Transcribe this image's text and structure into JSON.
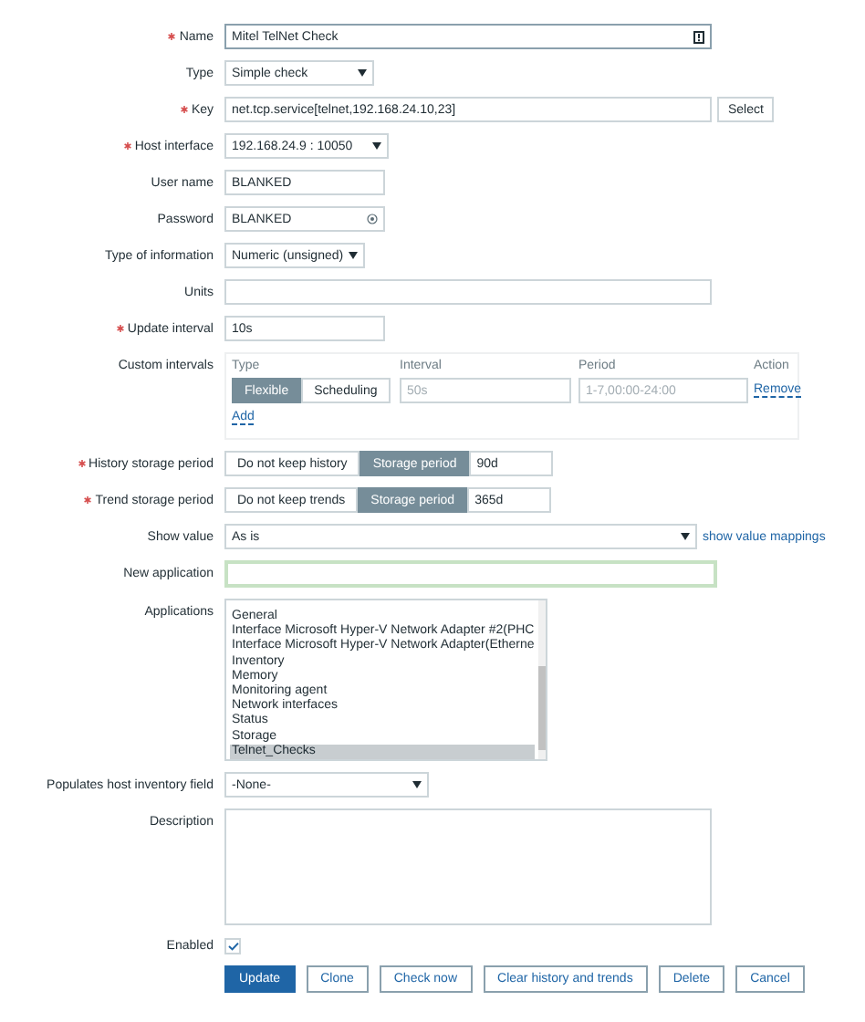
{
  "form": {
    "name": {
      "label": "Name",
      "required": true,
      "value": "Mitel TelNet Check"
    },
    "type": {
      "label": "Type",
      "required": false,
      "value": "Simple check"
    },
    "key": {
      "label": "Key",
      "required": true,
      "value": "net.tcp.service[telnet,192.168.24.10,23]",
      "button": "Select"
    },
    "host_interface": {
      "label": "Host interface",
      "required": true,
      "value": "192.168.24.9 : 10050"
    },
    "user_name": {
      "label": "User name",
      "required": false,
      "value": "BLANKED"
    },
    "password": {
      "label": "Password",
      "required": false,
      "value": "BLANKED"
    },
    "type_of_information": {
      "label": "Type of information",
      "required": false,
      "value": "Numeric (unsigned)"
    },
    "units": {
      "label": "Units",
      "required": false
    },
    "update_interval": {
      "label": "Update interval",
      "required": true,
      "value": "10s"
    },
    "custom_intervals": {
      "label": "Custom intervals",
      "columns": [
        "Type",
        "Interval",
        "Period",
        "Action"
      ],
      "rows": [
        {
          "type_options": [
            {
              "label": "Flexible",
              "selected": true
            },
            {
              "label": "Scheduling",
              "selected": false
            }
          ],
          "interval_placeholder": "50s",
          "period_placeholder": "1-7,00:00-24:00",
          "action": "Remove"
        }
      ],
      "add": "Add"
    },
    "history_storage_period": {
      "label": "History storage period",
      "required": true,
      "options": [
        {
          "label": "Do not keep history",
          "selected": false
        },
        {
          "label": "Storage period",
          "selected": true
        }
      ],
      "value": "90d"
    },
    "trend_storage_period": {
      "label": "Trend storage period",
      "required": true,
      "options": [
        {
          "label": "Do not keep trends",
          "selected": false
        },
        {
          "label": "Storage period",
          "selected": true
        }
      ],
      "value": "365d"
    },
    "show_value": {
      "label": "Show value",
      "required": false,
      "value": "As is",
      "link": "show value mappings"
    },
    "new_application": {
      "label": "New application",
      "required": false
    },
    "applications": {
      "label": "Applications",
      "items": [
        {
          "label": "General",
          "selected": false
        },
        {
          "label": "Interface Microsoft Hyper-V Network Adapter #2(PHC",
          "selected": false
        },
        {
          "label": "Interface Microsoft Hyper-V Network Adapter(Etherne",
          "selected": false
        },
        {
          "label": "Inventory",
          "selected": false
        },
        {
          "label": "Memory",
          "selected": false
        },
        {
          "label": "Monitoring agent",
          "selected": false
        },
        {
          "label": "Network interfaces",
          "selected": false
        },
        {
          "label": "Status",
          "selected": false
        },
        {
          "label": "Storage",
          "selected": false
        },
        {
          "label": "Telnet_Checks",
          "selected": true
        }
      ]
    },
    "populates_host_inventory_field": {
      "label": "Populates host inventory field",
      "required": false,
      "value": "-None-"
    },
    "description": {
      "label": "Description",
      "required": false
    },
    "enabled": {
      "label": "Enabled",
      "checked": true
    },
    "buttons": [
      {
        "label": "Update",
        "primary": true
      },
      {
        "label": "Clone",
        "primary": false
      },
      {
        "label": "Check now",
        "primary": false
      },
      {
        "label": "Clear history and trends",
        "primary": false
      },
      {
        "label": "Delete",
        "primary": false
      },
      {
        "label": "Cancel",
        "primary": false
      }
    ]
  }
}
